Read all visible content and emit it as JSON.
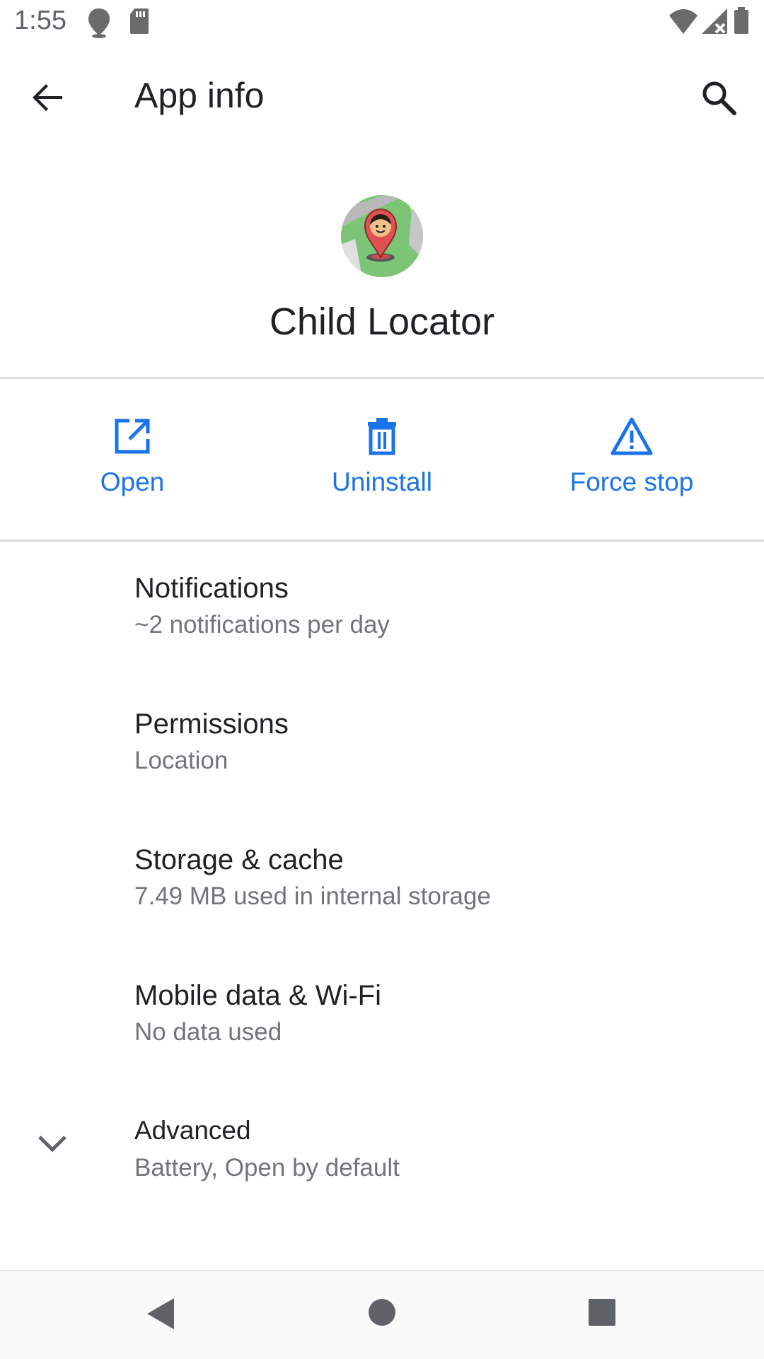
{
  "status_bar": {
    "time": "1:55"
  },
  "app_bar": {
    "title": "App info"
  },
  "app": {
    "name": "Child Locator"
  },
  "actions": [
    {
      "label": "Open",
      "icon": "open-in-new-icon"
    },
    {
      "label": "Uninstall",
      "icon": "trash-icon"
    },
    {
      "label": "Force stop",
      "icon": "warning-icon"
    }
  ],
  "settings": [
    {
      "title": "Notifications",
      "summary": "~2 notifications per day"
    },
    {
      "title": "Permissions",
      "summary": "Location"
    },
    {
      "title": "Storage & cache",
      "summary": "7.49 MB used in internal storage"
    },
    {
      "title": "Mobile data & Wi-Fi",
      "summary": "No data used"
    },
    {
      "title": "Advanced",
      "summary": "Battery, Open by default"
    }
  ],
  "colors": {
    "accent": "#1a73e8",
    "primary_text": "#202124",
    "secondary_text": "#70757a",
    "divider": "#dadce0"
  }
}
